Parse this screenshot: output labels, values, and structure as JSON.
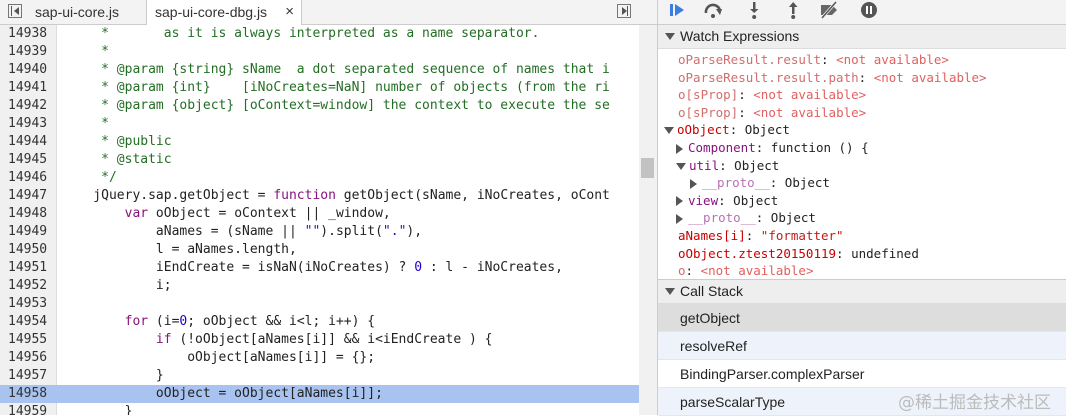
{
  "editor": {
    "tabs": [
      {
        "label": "sap-ui-core.js"
      },
      {
        "label": "sap-ui-core-dbg.js",
        "close": "×"
      }
    ],
    "lines": [
      {
        "num": "14938",
        "text": "         *       as it is always interpreted as a name separator."
      },
      {
        "num": "14939",
        "text": "         *"
      },
      {
        "num": "14940",
        "text": "         * @param {string} sName  a dot separated sequence of names that i"
      },
      {
        "num": "14941",
        "text": "         * @param {int}    [iNoCreates=NaN] number of objects (from the ri"
      },
      {
        "num": "14942",
        "text": "         * @param {object} [oContext=window] the context to execute the se"
      },
      {
        "num": "14943",
        "text": "         *"
      },
      {
        "num": "14944",
        "text": "         * @public"
      },
      {
        "num": "14945",
        "text": "         * @static"
      },
      {
        "num": "14946",
        "text": "         */"
      },
      {
        "num": "14947",
        "text": "        jQuery.sap.getObject = function getObject(sName, iNoCreates, oCont"
      },
      {
        "num": "14948",
        "text": "            var oObject = oContext || _window,"
      },
      {
        "num": "14949",
        "text": "                aNames = (sName || \"\").split(\".\"),"
      },
      {
        "num": "14950",
        "text": "                l = aNames.length,"
      },
      {
        "num": "14951",
        "text": "                iEndCreate = isNaN(iNoCreates) ? 0 : l - iNoCreates,"
      },
      {
        "num": "14952",
        "text": "                i;"
      },
      {
        "num": "14953",
        "text": ""
      },
      {
        "num": "14954",
        "text": "            for (i=0; oObject && i<l; i++) {"
      },
      {
        "num": "14955",
        "text": "                if (!oObject[aNames[i]] && i<iEndCreate ) {"
      },
      {
        "num": "14956",
        "text": "                    oObject[aNames[i]] = {};"
      },
      {
        "num": "14957",
        "text": "                }"
      },
      {
        "num": "14958",
        "text": "                oObject = oObject[aNames[i]];"
      },
      {
        "num": "14959",
        "text": "            }"
      }
    ],
    "highlighted_line": "14958"
  },
  "debugger": {
    "toolbar_icons": [
      "resume-icon",
      "step-over-icon",
      "step-into-icon",
      "step-out-icon",
      "deactivate-breakpoints-icon",
      "pause-on-exceptions-icon"
    ],
    "watch_title": "Watch Expressions",
    "watch": [
      {
        "name": "oParseResult.result",
        "value": "<not available>"
      },
      {
        "name": "oParseResult.result.path",
        "value": "<not available>"
      },
      {
        "name": "o[sProp]",
        "value": "<not available>"
      },
      {
        "name": "o[sProp]",
        "value": "<not available>"
      },
      {
        "name": "oObject",
        "value": "Object"
      },
      {
        "name": "Component",
        "value": "function () {"
      },
      {
        "name": "util",
        "value": "Object"
      },
      {
        "name": "__proto__",
        "value": "Object"
      },
      {
        "name": "view",
        "value": "Object"
      },
      {
        "name": "__proto__",
        "value": "Object"
      },
      {
        "name": "aNames[i]",
        "value": "\"formatter\""
      },
      {
        "name": "oObject.ztest20150119",
        "value": "undefined"
      },
      {
        "name": "o",
        "value": "<not available>"
      }
    ],
    "callstack_title": "Call Stack",
    "callstack": [
      "getObject",
      "resolveRef",
      "BindingParser.complexParser",
      "parseScalarType"
    ]
  },
  "watermark": "@稀土掘金技术社区"
}
